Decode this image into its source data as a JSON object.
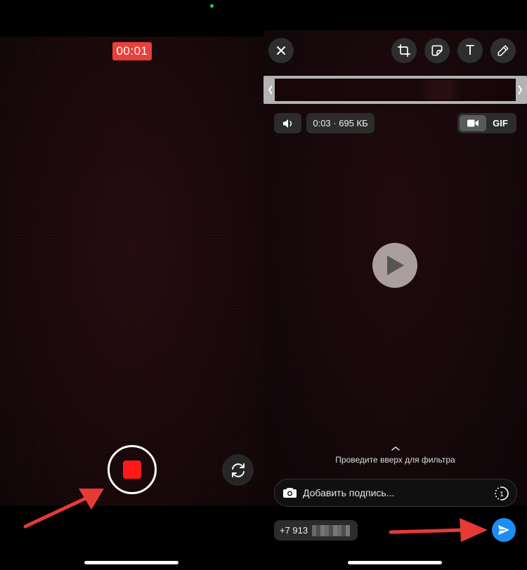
{
  "camera": {
    "timer": "00:01"
  },
  "editor": {
    "toolbar": {
      "text_tool_label": "T"
    },
    "media_info": "0:03 · 695 КБ",
    "format_gif_label": "GIF",
    "swipe_hint": "Проведите вверх для фильтра",
    "caption": {
      "placeholder": "Добавить подпись...",
      "value": "",
      "view_once_label": "1"
    },
    "recipient": "+7 913"
  },
  "colors": {
    "timer_bg": "#e8413b",
    "record_red": "#ff1a1a",
    "send_blue": "#1e8cf5",
    "annotation_arrow": "#e63a35"
  },
  "icons": {
    "close": "close-icon",
    "crop": "crop-rotate-icon",
    "sticker": "sticker-icon",
    "draw": "pencil-icon",
    "mute": "speaker-icon",
    "video_format": "video-camera-icon",
    "play": "play-icon",
    "caption_camera": "camera-icon",
    "view_once": "view-once-icon",
    "send": "send-icon",
    "flip": "flip-camera-icon"
  }
}
